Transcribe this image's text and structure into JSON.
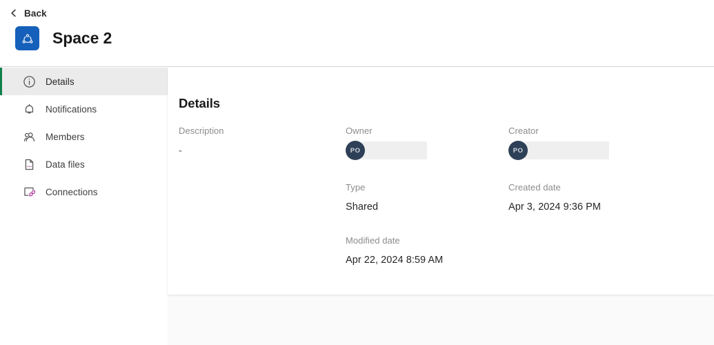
{
  "header": {
    "back_label": "Back",
    "back_icon": "chevron-left-icon",
    "space_icon": "space-nodes-icon",
    "title": "Space 2",
    "badge_color": "#1560ba"
  },
  "sidebar": {
    "active_accent_color": "#11804a",
    "items": [
      {
        "label": "Details",
        "icon": "info-circle-icon",
        "active": true
      },
      {
        "label": "Notifications",
        "icon": "bell-icon",
        "active": false
      },
      {
        "label": "Members",
        "icon": "users-icon",
        "active": false
      },
      {
        "label": "Data files",
        "icon": "data-file-icon",
        "active": false
      },
      {
        "label": "Connections",
        "icon": "connections-icon",
        "active": false
      }
    ]
  },
  "main": {
    "card_title": "Details",
    "fields": {
      "description": {
        "label": "Description",
        "value": "-"
      },
      "owner": {
        "label": "Owner",
        "avatar_initials": "PO",
        "value_redacted": true
      },
      "creator": {
        "label": "Creator",
        "avatar_initials": "PO",
        "value_redacted": true
      },
      "type": {
        "label": "Type",
        "value": "Shared"
      },
      "created_date": {
        "label": "Created date",
        "value": "Apr 3, 2024 9:36 PM"
      },
      "modified_date": {
        "label": "Modified date",
        "value": "Apr 22, 2024 8:59 AM"
      }
    }
  }
}
